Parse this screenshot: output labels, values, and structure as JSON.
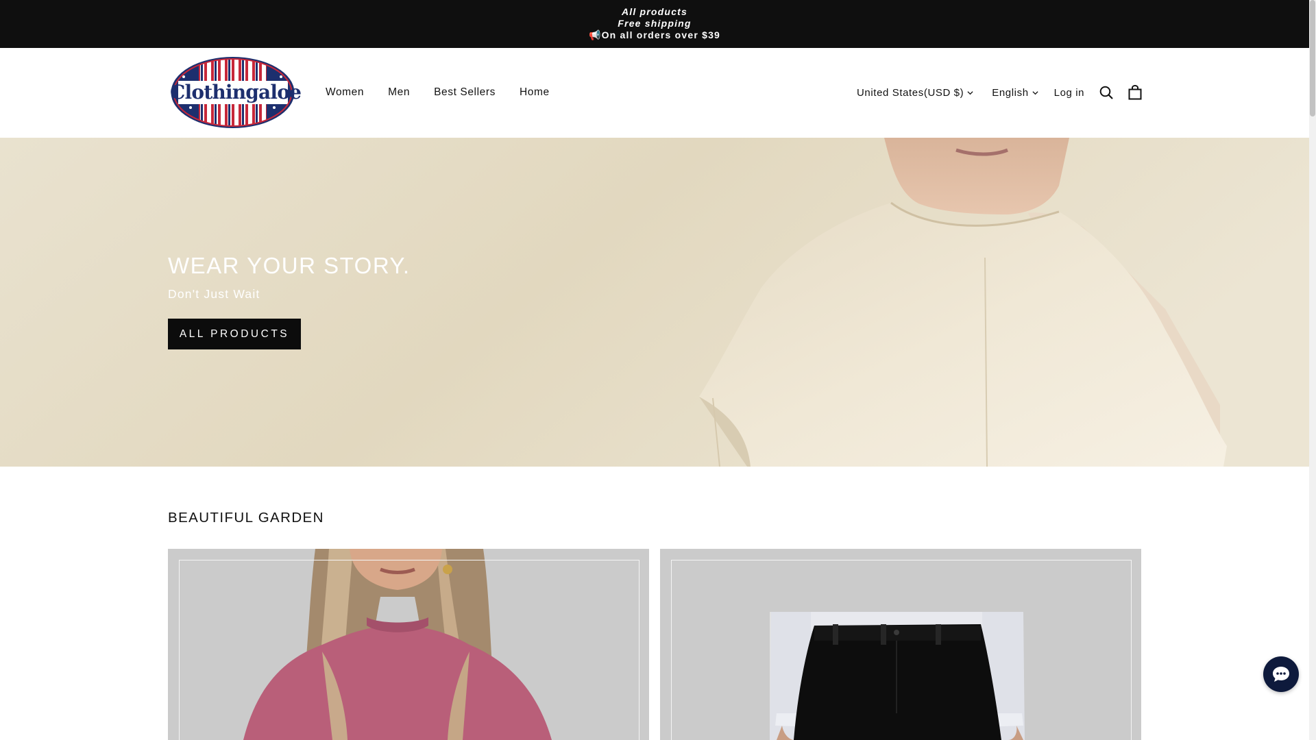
{
  "announcement": {
    "line1": "All products",
    "line2": "Free shipping",
    "line3_icon": "megaphone-icon",
    "line3_emoji": "📢",
    "line3": "On all orders over $39"
  },
  "header": {
    "logo_text": "Clothingaloe",
    "nav": [
      "Women",
      "Men",
      "Best Sellers",
      "Home"
    ],
    "country": "United States(USD $)",
    "language": "English",
    "login": "Log in",
    "icons": [
      "search-icon",
      "shopping-bag-icon"
    ]
  },
  "hero": {
    "title": "WEAR YOUR STORY.",
    "subtitle": "Don't Just Wait",
    "button": "ALL PRODUCTS"
  },
  "collection": {
    "title": "BEAUTIFUL GARDEN",
    "cards": [
      "women-pink-top-image",
      "men-black-trousers-image"
    ]
  },
  "chat": {
    "icon": "chat-bubble-icon"
  },
  "colors": {
    "announcement_bg": "#0f0f0f",
    "button_bg": "#0c0c0c",
    "card_bg": "#cbcbcb",
    "chat_bg": "#0e1a3c",
    "logo_blue": "#1d2f6e",
    "logo_red": "#c7283a"
  }
}
